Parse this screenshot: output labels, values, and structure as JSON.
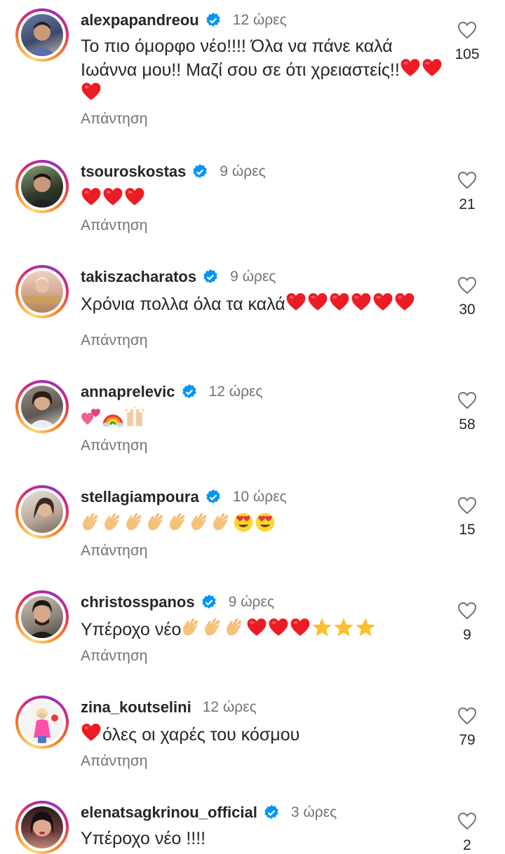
{
  "reply_label": "Απάντηση",
  "colors": {
    "verified": "#0095f6",
    "heart_red": "#ed1c24",
    "muted": "#737373"
  },
  "comments": [
    {
      "username": "alexpapandreou",
      "time": "12 ώρες",
      "text": "Το πιο όμορφο νέο!!!! Όλα να πάνε καλά Ιωάννα μου!! Μαζί σου σε ότι χρειαστείς!!",
      "emojis": [
        "red-heart",
        "red-heart",
        "red-heart"
      ],
      "likes": "105",
      "verified": true
    },
    {
      "username": "tsouroskostas",
      "time": "9 ώρες",
      "text": "",
      "emojis": [
        "red-heart",
        "red-heart",
        "red-heart"
      ],
      "likes": "21",
      "verified": true
    },
    {
      "username": "takiszacharatos",
      "time": "9 ώρες",
      "text": "Χρόνια πολλα όλα τα καλά",
      "emojis": [
        "red-heart",
        "red-heart",
        "red-heart",
        "red-heart",
        "red-heart",
        "red-heart"
      ],
      "likes": "30",
      "verified": true
    },
    {
      "username": "annaprelevic",
      "time": "12 ώρες",
      "text": "",
      "emojis": [
        "two-hearts",
        "rainbow",
        "raised-hands"
      ],
      "likes": "58",
      "verified": true
    },
    {
      "username": "stellagiampoura",
      "time": "10 ώρες",
      "text": "",
      "emojis": [
        "clap",
        "clap",
        "clap",
        "clap",
        "clap",
        "clap",
        "clap",
        "heart-eyes",
        "heart-eyes"
      ],
      "likes": "15",
      "verified": true
    },
    {
      "username": "christosspanos",
      "time": "9 ώρες",
      "text": "Υπέροχο νέο",
      "emojis": [
        "clap",
        "clap",
        "clap",
        "red-heart",
        "red-heart",
        "red-heart",
        "star",
        "star",
        "star"
      ],
      "likes": "9",
      "verified": true
    },
    {
      "username": "zina_koutselini",
      "time": "12 ώρες",
      "text_before": "",
      "text": "όλες οι χαρές του κόσμου",
      "emojis_before": [
        "red-heart"
      ],
      "emojis": [],
      "likes": "79",
      "verified": false
    },
    {
      "username": "elenatsagkrinou_official",
      "time": "3 ώρες",
      "text": "Υπέροχο νέο !!!!",
      "emojis": [],
      "likes": "2",
      "verified": true
    }
  ]
}
